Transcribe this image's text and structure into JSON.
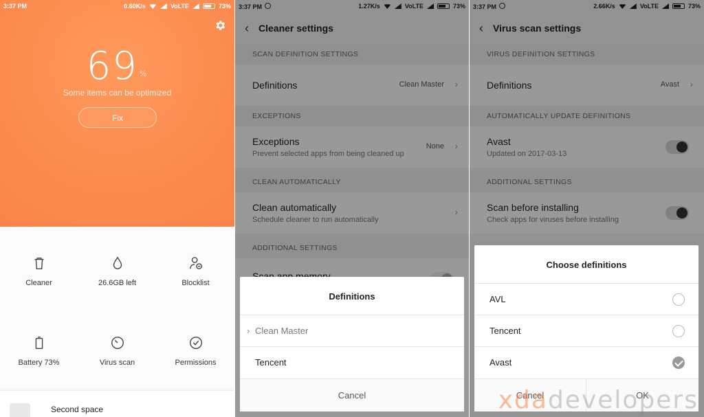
{
  "panel1": {
    "status": {
      "time": "3:37 PM",
      "speed": "0.60K/s",
      "network": "VoLTE",
      "battery": "73%"
    },
    "score": "69",
    "score_unit": "%",
    "subtitle": "Some items can be optimized",
    "fix_label": "Fix",
    "tools": [
      {
        "label": "Cleaner",
        "icon": "trash-icon"
      },
      {
        "label": "26.6GB left",
        "icon": "drop-icon"
      },
      {
        "label": "Blocklist",
        "icon": "blocklist-icon"
      },
      {
        "label": "Battery 73%",
        "icon": "battery-icon"
      },
      {
        "label": "Virus scan",
        "icon": "virus-scan-icon"
      },
      {
        "label": "Permissions",
        "icon": "check-circle-icon"
      }
    ],
    "second_space": "Second space"
  },
  "panel2": {
    "status": {
      "time": "3:37 PM",
      "speed": "1.27K/s",
      "network": "VoLTE",
      "battery": "73%"
    },
    "title": "Cleaner settings",
    "sections": [
      {
        "header": "SCAN DEFINITION SETTINGS"
      },
      {
        "header": "EXCEPTIONS"
      },
      {
        "header": "CLEAN AUTOMATICALLY"
      },
      {
        "header": "ADDITIONAL SETTINGS"
      }
    ],
    "rows": [
      {
        "title": "Definitions",
        "value": "Clean Master"
      },
      {
        "title": "Exceptions",
        "sub": "Prevent selected apps from being cleaned up",
        "value": "None"
      },
      {
        "title": "Clean automatically",
        "sub": "Schedule cleaner to run automatically"
      },
      {
        "title": "Scan app memory"
      }
    ],
    "dialog": {
      "title": "Definitions",
      "options": [
        "Clean Master",
        "Tencent"
      ],
      "cancel": "Cancel"
    }
  },
  "panel3": {
    "status": {
      "time": "3:37 PM",
      "speed": "2.66K/s",
      "network": "VoLTE",
      "battery": "73%"
    },
    "title": "Virus scan settings",
    "sections": [
      {
        "header": "VIRUS DEFINITION SETTINGS"
      },
      {
        "header": "AUTOMATICALLY UPDATE DEFINITIONS"
      },
      {
        "header": "ADDITIONAL SETTINGS"
      }
    ],
    "rows": [
      {
        "title": "Definitions",
        "value": "Avast"
      },
      {
        "title": "Avast",
        "sub": "Updated on 2017-03-13"
      },
      {
        "title": "Scan before installing",
        "sub": "Check apps for viruses before installing"
      }
    ],
    "dialog": {
      "title": "Choose definitions",
      "options": [
        "AVL",
        "Tencent",
        "Avast"
      ],
      "selected": "Avast",
      "cancel": "Cancel",
      "ok": "OK"
    }
  },
  "watermark": {
    "part1": "xda",
    "part2": "developers"
  },
  "colors": {
    "accent": "#fb8a4e"
  }
}
